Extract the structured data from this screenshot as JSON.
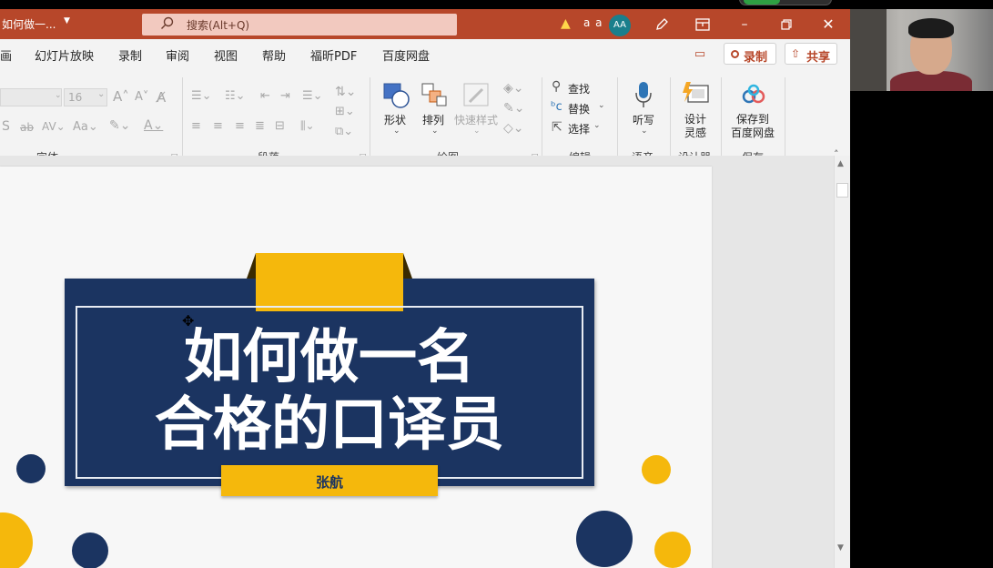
{
  "window": {
    "doc_title": "如何做一...",
    "search_placeholder": "搜索(Alt+Q)",
    "font_size_toggle": "a a",
    "avatar_initials": "AA"
  },
  "tabs": [
    {
      "label": "画"
    },
    {
      "label": "幻灯片放映"
    },
    {
      "label": "录制"
    },
    {
      "label": "审阅"
    },
    {
      "label": "视图"
    },
    {
      "label": "帮助"
    },
    {
      "label": "福昕PDF"
    },
    {
      "label": "百度网盘"
    }
  ],
  "header_buttons": {
    "record_label": "录制",
    "share_label": "共享"
  },
  "ribbon": {
    "font": {
      "size_value": "16",
      "group_label": "字体"
    },
    "paragraph": {
      "group_label": "段落"
    },
    "drawing": {
      "shape_label": "形状",
      "arrange_label": "排列",
      "quick_styles_label": "快速样式",
      "group_label": "绘图"
    },
    "editing": {
      "find_label": "查找",
      "replace_label": "替换",
      "select_label": "选择",
      "group_label": "编辑"
    },
    "voice": {
      "dictate_label": "听写",
      "group_label": "语音"
    },
    "designer": {
      "line1": "设计",
      "line2": "灵感",
      "group_label": "设计器"
    },
    "save": {
      "line1": "保存到",
      "line2": "百度网盘",
      "group_label": "保存"
    }
  },
  "slide": {
    "title_line1": "如何做一名",
    "title_line2": "合格的口译员",
    "presenter": "张航"
  },
  "colors": {
    "titlebar": "#b7472a",
    "navy": "#1b3461",
    "yellow": "#f5b80c"
  }
}
